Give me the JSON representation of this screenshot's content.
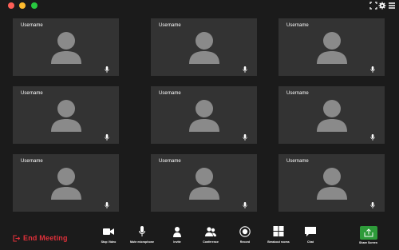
{
  "window": {
    "controls": [
      "close",
      "minimize",
      "maximize"
    ],
    "top_right_icons": [
      "fullscreen-icon",
      "gear-icon",
      "menu-icon"
    ]
  },
  "participants": [
    {
      "name": "Username"
    },
    {
      "name": "Username"
    },
    {
      "name": "Username"
    },
    {
      "name": "Username"
    },
    {
      "name": "Username"
    },
    {
      "name": "Username"
    },
    {
      "name": "Username"
    },
    {
      "name": "Username"
    },
    {
      "name": "Username"
    }
  ],
  "toolbar": {
    "end_meeting_label": "End Meeting",
    "stop_video_label": "Stop Video",
    "mute_label": "Mute microphone",
    "invite_label": "Invite",
    "conference_label": "Conference",
    "record_label": "Record",
    "breakout_label": "Breakout rooms",
    "chat_label": "Chat",
    "share_label": "Share Screen"
  },
  "colors": {
    "background": "#1b1b1b",
    "tile": "#333333",
    "end_meeting": "#e0303a",
    "share": "#2e9b3a"
  }
}
